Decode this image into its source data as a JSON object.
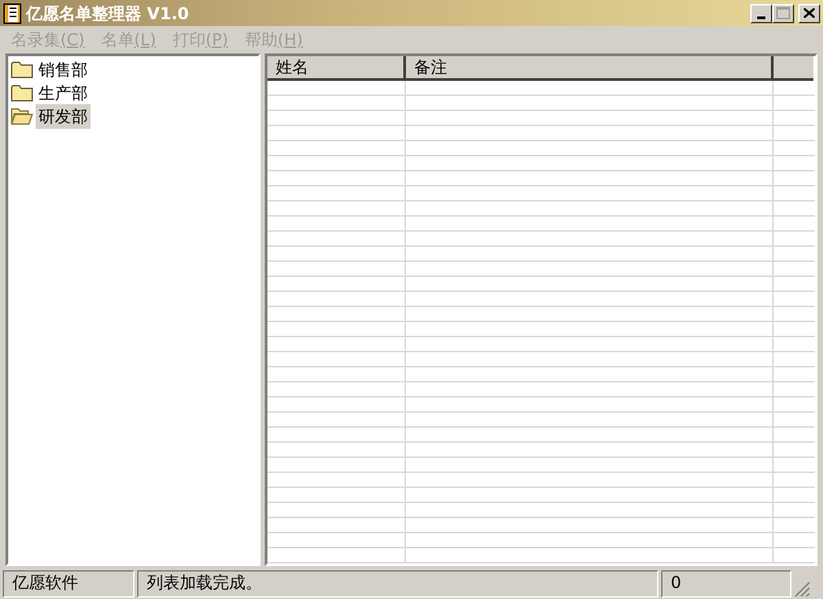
{
  "window": {
    "title": "亿愿名单整理器 V1.0"
  },
  "menu": [
    {
      "label": "名录集",
      "key": "(C)",
      "disabled": true
    },
    {
      "label": "名单",
      "key": "(L)",
      "disabled": true
    },
    {
      "label": "打印",
      "key": "(P)",
      "disabled": true
    },
    {
      "label": "帮助",
      "key": "(H)",
      "disabled": true
    }
  ],
  "tree": [
    {
      "label": "销售部",
      "selected": false
    },
    {
      "label": "生产部",
      "selected": false
    },
    {
      "label": "研发部",
      "selected": true
    }
  ],
  "table": {
    "columns": [
      "姓名",
      "备注"
    ]
  },
  "status_bar": [
    "亿愿软件",
    "列表加载完成。",
    "0"
  ]
}
